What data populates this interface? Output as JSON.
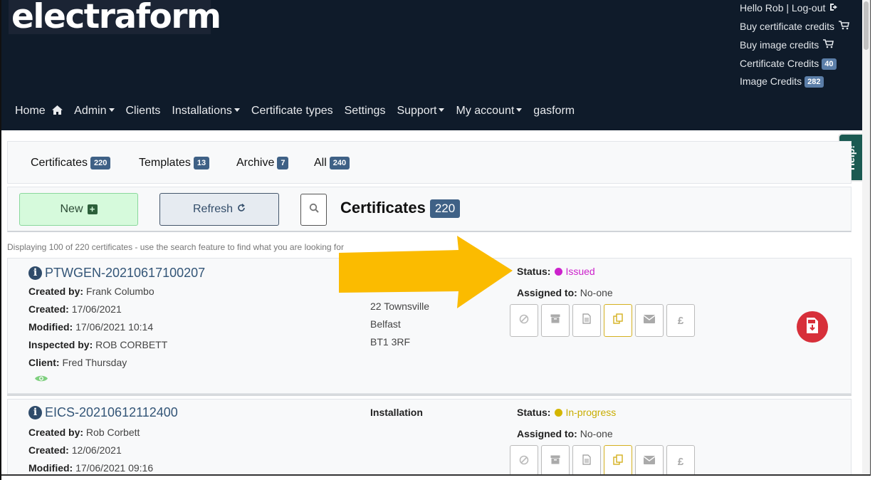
{
  "header": {
    "logo": "electraform",
    "user_links": [
      {
        "label": "Hello Rob | Log-out",
        "icon": "logout-icon"
      },
      {
        "label": "Buy certificate credits",
        "icon": "cart-icon"
      },
      {
        "label": "Buy image credits",
        "icon": "cart-icon"
      },
      {
        "label": "Certificate Credits",
        "badge": "40"
      },
      {
        "label": "Image Credits",
        "badge": "282"
      }
    ],
    "nav": [
      "Home",
      "Admin",
      "Clients",
      "Installations",
      "Certificate types",
      "Settings",
      "Support",
      "My account",
      "gasform"
    ]
  },
  "help_tab": "Help!",
  "tabs": [
    {
      "label": "Certificates",
      "count": "220"
    },
    {
      "label": "Templates",
      "count": "13"
    },
    {
      "label": "Archive",
      "count": "7"
    },
    {
      "label": "All",
      "count": "240"
    }
  ],
  "toolbar": {
    "new_label": "New",
    "refresh_label": "Refresh",
    "title": "Certificates",
    "title_count": "220"
  },
  "display_note": "Displaying 100 of 220 certificates - use the search feature to find what you are looking for",
  "certificates": [
    {
      "id": "PTWGEN-20210617100207",
      "created_by_label": "Created by:",
      "created_by": "Frank Columbo",
      "created_label": "Created:",
      "created": "17/06/2021",
      "modified_label": "Modified:",
      "modified": "17/06/2021 10:14",
      "inspected_label": "Inspected by:",
      "inspected_by": "ROB CORBETT",
      "client_label": "Client:",
      "client": "Fred Thursday",
      "address": [
        "22 Townsville",
        "Belfast",
        "BT1 3RF"
      ],
      "status_label": "Status:",
      "status": "Issued",
      "status_color": "#cc22cc",
      "assigned_label": "Assigned to:",
      "assigned_to": "No-one"
    },
    {
      "id": "EICS-20210612112400",
      "created_by_label": "Created by:",
      "created_by": "Rob Corbett",
      "created_label": "Created:",
      "created": "12/06/2021",
      "modified_label": "Modified:",
      "modified": "17/06/2021 09:16",
      "installation_label": "Installation",
      "status_label": "Status:",
      "status": "In-progress",
      "status_color": "#d4b600",
      "assigned_label": "Assigned to:",
      "assigned_to": "No-one"
    }
  ],
  "actions": [
    "cancel-icon",
    "archive-icon",
    "document-icon",
    "copy-icon",
    "email-icon",
    "pound-icon"
  ],
  "colors": {
    "header_bg": "#0f1b2a",
    "badge": "#3f6186",
    "arrow": "#fbbb00",
    "pdf": "#d7303a"
  }
}
